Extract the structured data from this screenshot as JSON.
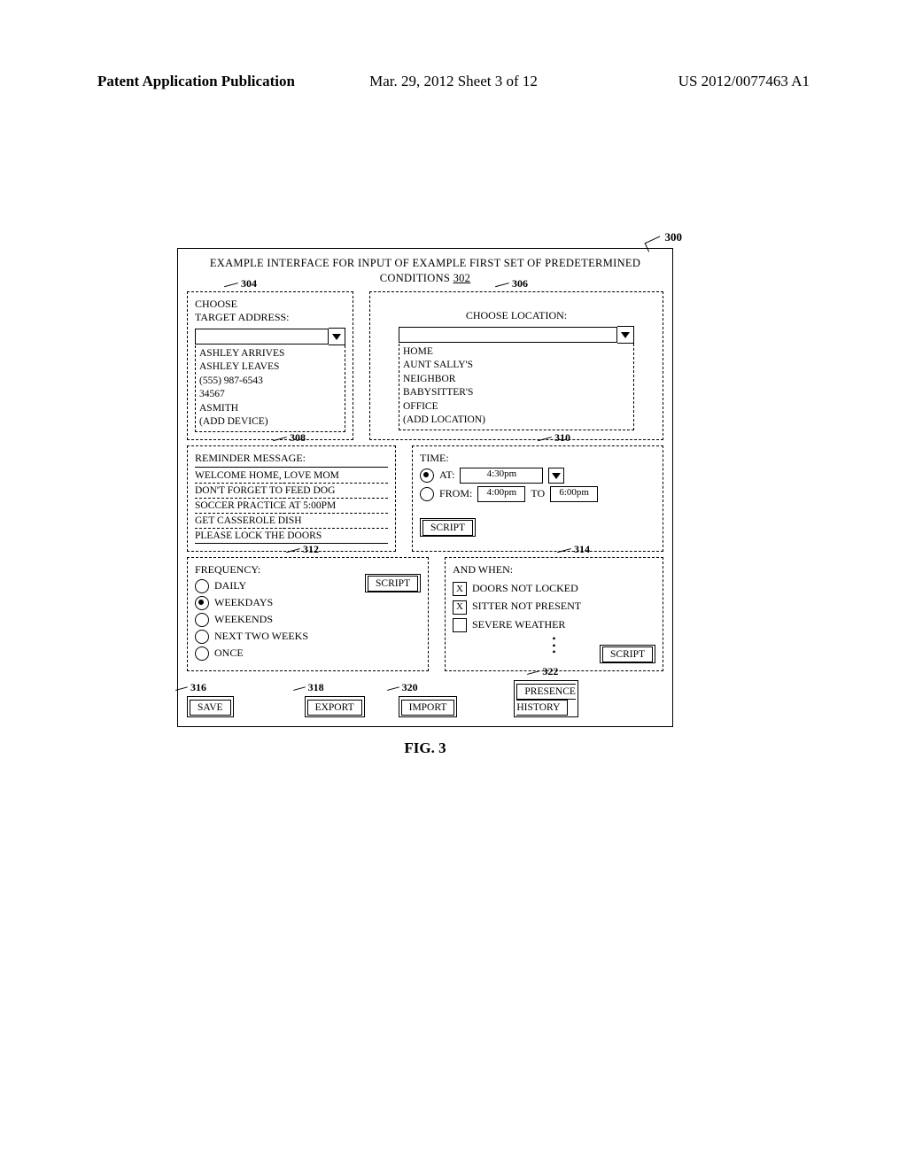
{
  "header": {
    "left": "Patent Application Publication",
    "center": "Mar. 29, 2012  Sheet 3 of 12",
    "right": "US 2012/0077463 A1"
  },
  "refs": {
    "r300": "300",
    "r302": "302",
    "r304": "304",
    "r306": "306",
    "r308": "308",
    "r310": "310",
    "r312": "312",
    "r314": "314",
    "r316": "316",
    "r318": "318",
    "r320": "320",
    "r322": "322"
  },
  "title_line1": "EXAMPLE INTERFACE FOR INPUT OF EXAMPLE FIRST SET OF PREDETERMINED",
  "title_line2_a": "CONDITIONS ",
  "panel304": {
    "label_l1": "CHOOSE",
    "label_l2": "TARGET ADDRESS:",
    "opts": [
      "ASHLEY ARRIVES",
      "ASHLEY LEAVES",
      "(555) 987-6543",
      "34567",
      "ASMITH",
      "(ADD DEVICE)"
    ]
  },
  "panel306": {
    "label": "CHOOSE LOCATION:",
    "opts": [
      "HOME",
      "AUNT SALLY'S",
      "NEIGHBOR",
      "BABYSITTER'S",
      "OFFICE",
      "(ADD LOCATION)"
    ]
  },
  "panel308": {
    "label": "REMINDER MESSAGE:",
    "msgs": [
      "WELCOME HOME, LOVE MOM",
      "DON'T FORGET TO FEED DOG",
      "SOCCER PRACTICE AT 5:00PM",
      "GET CASSEROLE DISH",
      "PLEASE LOCK THE DOORS"
    ]
  },
  "panel310": {
    "label": "TIME:",
    "at_label": "AT:",
    "at_value": "4:30pm",
    "from_label": "FROM:",
    "from_value": "4:00pm",
    "to_label": "TO",
    "to_value": "6:00pm",
    "script": "SCRIPT"
  },
  "panel312": {
    "label": "FREQUENCY:",
    "opts": [
      "DAILY",
      "WEEKDAYS",
      "WEEKENDS",
      "NEXT TWO WEEKS",
      "ONCE"
    ],
    "script": "SCRIPT"
  },
  "panel314": {
    "label": "AND WHEN:",
    "opts": [
      "DOORS NOT LOCKED",
      "SITTER NOT PRESENT",
      "SEVERE WEATHER"
    ],
    "script": "SCRIPT"
  },
  "buttons": {
    "save": "SAVE",
    "export": "EXPORT",
    "import": "IMPORT",
    "presence_l1": "PRESENCE",
    "presence_l2": "HISTORY"
  },
  "fig_caption": "FIG. 3"
}
